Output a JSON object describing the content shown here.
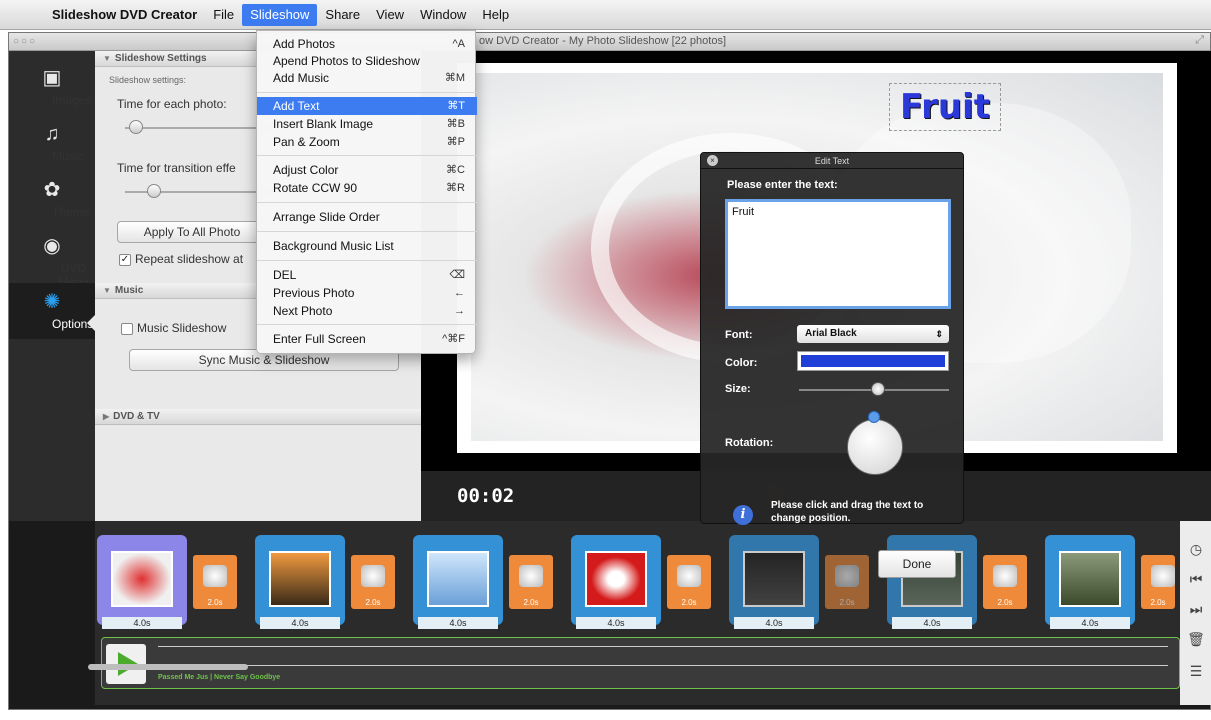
{
  "menubar": {
    "app_name": "Slideshow DVD Creator",
    "items": [
      "File",
      "Slideshow",
      "Share",
      "View",
      "Window",
      "Help"
    ],
    "active": "Slideshow"
  },
  "window": {
    "title_visible": "ow DVD Creator - My Photo Slideshow [22 photos]"
  },
  "leftnav": {
    "items": [
      {
        "label": "Images",
        "icon": "images-icon"
      },
      {
        "label": "Music",
        "icon": "music-note-icon"
      },
      {
        "label": "Theme",
        "icon": "palette-icon"
      },
      {
        "label": "DVD Menu",
        "icon": "disc-icon"
      },
      {
        "label": "Options",
        "icon": "gear-icon"
      }
    ],
    "selected": "Options"
  },
  "settings": {
    "section_title": "Slideshow Settings",
    "subtitle": "Slideshow settings:",
    "time_each_photo_label": "Time for each photo:",
    "time_transition_label": "Time for transition effe",
    "apply_button": "Apply To All Photo",
    "repeat_label": "Repeat slideshow at",
    "repeat_checked": true,
    "music_section": "Music",
    "music_slideshow_label": "Music Slideshow",
    "music_slideshow_checked": false,
    "sync_button": "Sync Music & Slideshow",
    "dvd_section": "DVD & TV"
  },
  "preview": {
    "overlay_text": "Fruit",
    "overlay_color": "#2a39d8",
    "timecode": "00:02"
  },
  "edit_text_dialog": {
    "title": "Edit Text",
    "prompt": "Please enter the text:",
    "text_value": "Fruit",
    "font_label": "Font:",
    "font_value": "Arial Black",
    "color_label": "Color:",
    "color_value": "#1f3fd8",
    "size_label": "Size:",
    "rotation_label": "Rotation:",
    "hint": "Please click and drag the text to change position.",
    "done_button": "Done"
  },
  "timeline": {
    "photos": [
      {
        "duration": "4.0s"
      },
      {
        "duration": "4.0s"
      },
      {
        "duration": "4.0s"
      },
      {
        "duration": "4.0s"
      },
      {
        "duration": "4.0s"
      },
      {
        "duration": "4.0s"
      },
      {
        "duration": "4.0s"
      }
    ],
    "transitions": [
      {
        "duration": "2.0s"
      },
      {
        "duration": "2.0s"
      },
      {
        "duration": "2.0s"
      },
      {
        "duration": "2.0s"
      },
      {
        "duration": "2.0s"
      },
      {
        "duration": "2.0s"
      },
      {
        "duration": "2.0s"
      }
    ],
    "audio_label": "Passed Me Jus | Never Say Goodbye"
  },
  "right_tools": [
    "clock-icon",
    "skip-back-icon",
    "skip-forward-icon",
    "trash-icon",
    "list-icon"
  ],
  "dropdown": {
    "items": [
      {
        "label": "Add Photos",
        "shortcut": "^A"
      },
      {
        "label": "Apend Photos to Slideshow",
        "shortcut": ""
      },
      {
        "label": "Add Music",
        "shortcut": "⌘M"
      },
      {
        "label": "Add Text",
        "shortcut": "⌘T",
        "highlighted": true
      },
      {
        "label": "Insert Blank Image",
        "shortcut": "⌘B"
      },
      {
        "label": "Pan & Zoom",
        "shortcut": "⌘P"
      },
      {
        "label": "Adjust Color",
        "shortcut": "⌘C"
      },
      {
        "label": "Rotate CCW 90",
        "shortcut": "⌘R"
      },
      {
        "label": "Arrange Slide Order",
        "shortcut": ""
      },
      {
        "label": "Background Music List",
        "shortcut": ""
      },
      {
        "label": "DEL",
        "shortcut": "⌫"
      },
      {
        "label": "Previous Photo",
        "shortcut": "←"
      },
      {
        "label": "Next Photo",
        "shortcut": "→"
      },
      {
        "label": "Enter Full Screen",
        "shortcut": "^⌘F"
      }
    ]
  }
}
